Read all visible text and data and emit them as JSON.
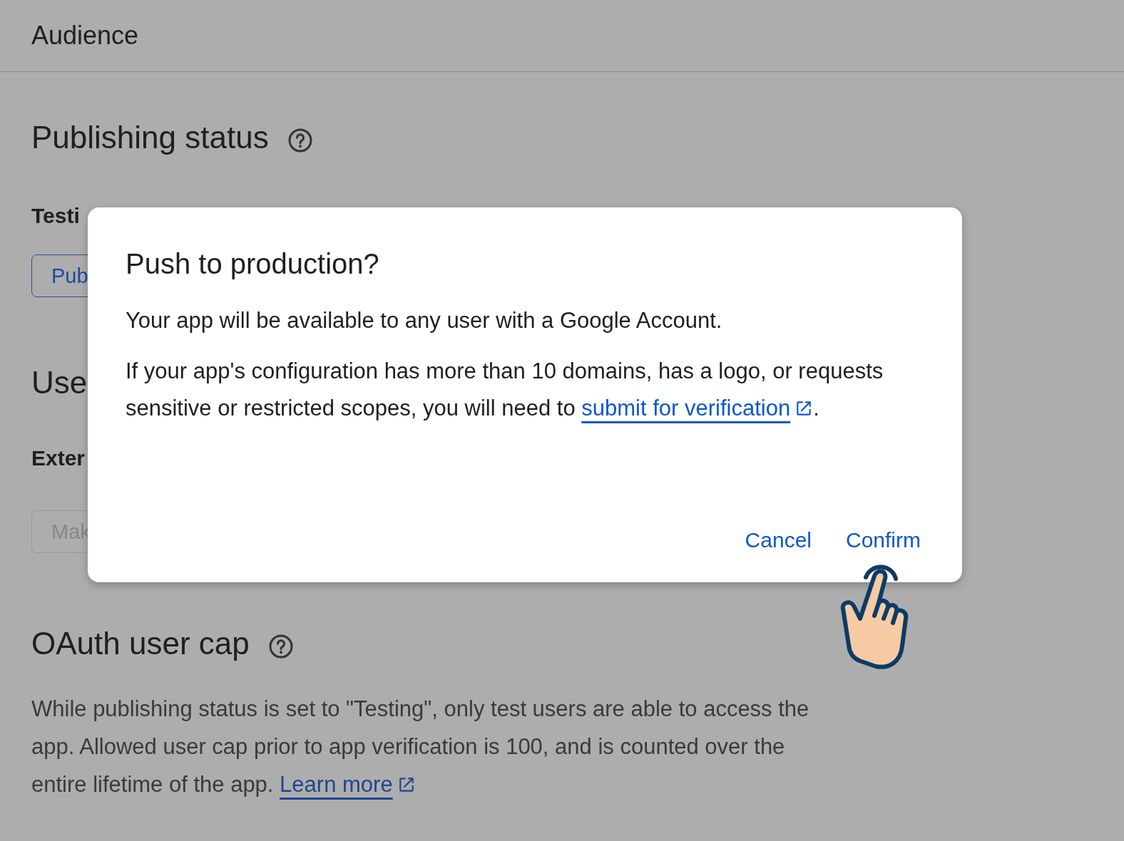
{
  "header": {
    "title": "Audience"
  },
  "publishing_status": {
    "heading": "Publishing status",
    "status": "Testi",
    "button": {
      "label": "Pub",
      "disabled": false
    }
  },
  "user_type": {
    "heading": "Use",
    "type": "Exter",
    "button": {
      "label": "Mak",
      "disabled": true
    }
  },
  "oauth_user_cap": {
    "heading": "OAuth user cap",
    "description": "While publishing status is set to \"Testing\", only test users are able to access the app. Allowed user cap prior to app verification is 100, and is counted over the entire lifetime of the app.",
    "link": "Learn more"
  },
  "dialog": {
    "title": "Push to production?",
    "message": "Your app will be available to any user with a Google Account.",
    "details": "If your app's configuration has more than 10 domains, has a logo, or requests sensitive or restricted scopes, you will need to",
    "details_link": "submit for verification",
    "details_end": ".",
    "buttons": [
      {
        "label": "Cancel"
      },
      {
        "label": "Confirm"
      }
    ]
  }
}
